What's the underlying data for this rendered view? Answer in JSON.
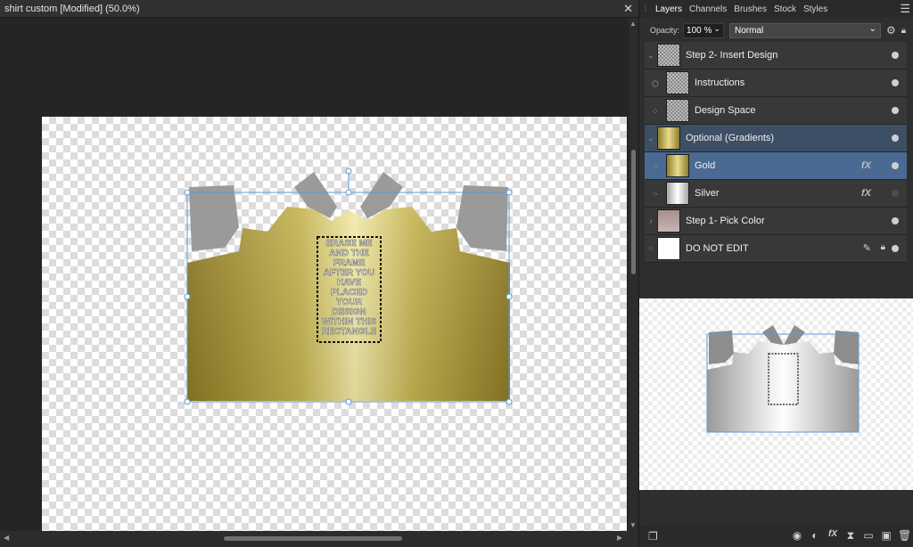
{
  "document": {
    "title": "shirt custom [Modified] (50.0%)",
    "close_glyph": "✕",
    "artwork_text": [
      "ERASE ME",
      "AND THE",
      "FRAME",
      "AFTER YOU",
      "HAVE",
      "PLACED",
      "YOUR",
      "DESIGN",
      "WITHIN THIS",
      "RECTANGLE"
    ]
  },
  "panel": {
    "tabs": [
      "Layers",
      "Channels",
      "Brushes",
      "Stock",
      "Styles"
    ],
    "active_tab": "Layers",
    "opacity_label": "Opacity:",
    "opacity_value": "100 %",
    "blend_mode": "Normal"
  },
  "layers": [
    {
      "name": "Step 2- Insert Design",
      "expander": "⌄",
      "visible": true
    },
    {
      "name": "Instructions",
      "child": true,
      "visible": true
    },
    {
      "name": "Design Space",
      "child": true,
      "visible": true
    },
    {
      "name": "Optional (Gradients)",
      "expander": "⌄",
      "visible": true,
      "group_selected": true
    },
    {
      "name": "Gold",
      "child": true,
      "fx": "fX",
      "visible": true,
      "selected": true
    },
    {
      "name": "Silver",
      "child": true,
      "fx": "fX",
      "visible": false
    },
    {
      "name": "Step 1- Pick Color",
      "expander": "›",
      "visible": true
    },
    {
      "name": "DO NOT EDIT",
      "visible": true,
      "locked": true
    }
  ],
  "icons": {
    "close": "close-icon",
    "panel_menu": "hamburger-menu-icon",
    "settings": "gear-icon",
    "lock": "lock-icon",
    "fx": "fx-icon",
    "visibility": "visibility-dot-icon"
  }
}
